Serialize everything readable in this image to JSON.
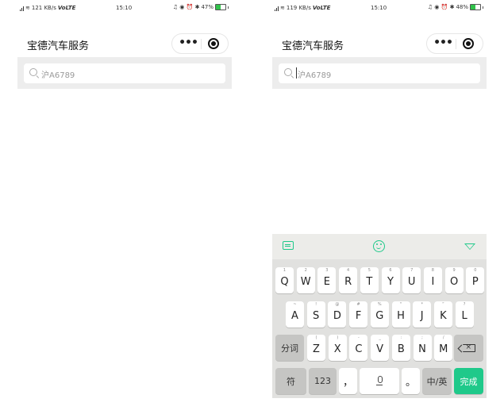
{
  "left": {
    "status": {
      "signal": "⁵ᴳ",
      "speed": "121 KB/s",
      "volte": "VoLTE",
      "time": "15:10",
      "battery_label": "47%",
      "battery": 0.47,
      "icons": "♫ ◉ ⏰ ✱"
    },
    "app_title": "宝德汽车服务",
    "search_text": "沪A6789"
  },
  "right": {
    "status": {
      "signal": "⁵ᴳ",
      "speed": "119 KB/s",
      "volte": "VoLTE",
      "time": "15:10",
      "battery_label": "48%",
      "battery": 0.48,
      "icons": "♫ ◉ ⏰ ✱"
    },
    "app_title": "宝德汽车服务",
    "search_text": "沪A6789",
    "keyboard": {
      "row1": [
        [
          "Q",
          "1"
        ],
        [
          "W",
          "2"
        ],
        [
          "E",
          "3"
        ],
        [
          "R",
          "4"
        ],
        [
          "T",
          "5"
        ],
        [
          "Y",
          "6"
        ],
        [
          "U",
          "7"
        ],
        [
          "I",
          "8"
        ],
        [
          "O",
          "9"
        ],
        [
          "P",
          "0"
        ]
      ],
      "row2": [
        [
          "A",
          "~"
        ],
        [
          "S",
          "!"
        ],
        [
          "D",
          "@"
        ],
        [
          "F",
          "#"
        ],
        [
          "G",
          "%"
        ],
        [
          "H",
          "\""
        ],
        [
          "J",
          "*"
        ],
        [
          "K",
          "“"
        ],
        [
          "L",
          "?"
        ]
      ],
      "row3_left": "分词",
      "row3": [
        [
          "Z",
          "("
        ],
        [
          "X",
          ")"
        ],
        [
          "C",
          "-"
        ],
        [
          "V",
          "_"
        ],
        [
          "B",
          ":"
        ],
        [
          "N",
          ";"
        ],
        [
          "M",
          "/"
        ]
      ],
      "symbol_key": "符",
      "numbers_key": "123",
      "comma_key": "，",
      "period_key": "。",
      "lang_key": "中/英",
      "done_key": "完成"
    }
  },
  "colors": {
    "accent": "#1fc98a",
    "search_bg": "#ededed",
    "keyboard_bg": "#e1e1df"
  }
}
